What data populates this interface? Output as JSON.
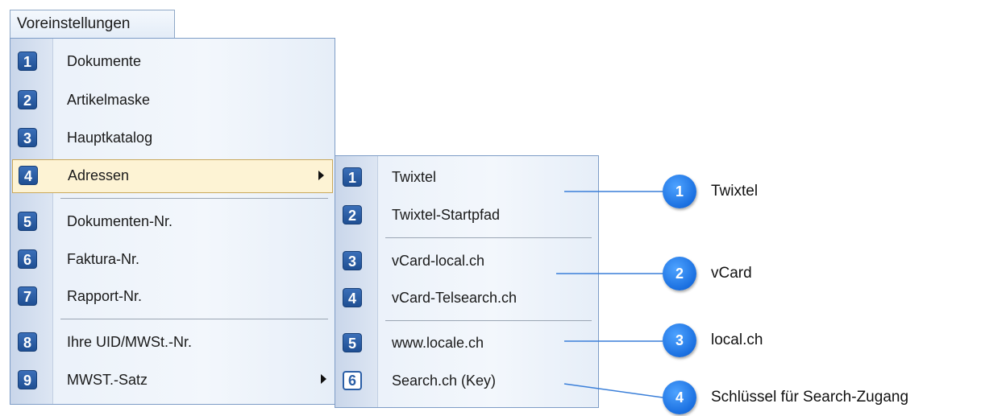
{
  "menubar": {
    "title": "Voreinstellungen"
  },
  "main_menu": {
    "items": [
      {
        "num": "1",
        "label": "Dokumente"
      },
      {
        "num": "2",
        "label": "Artikelmaske"
      },
      {
        "num": "3",
        "label": "Hauptkatalog"
      },
      {
        "num": "4",
        "label": "Adressen"
      },
      {
        "num": "5",
        "label": "Dokumenten-Nr."
      },
      {
        "num": "6",
        "label": "Faktura-Nr."
      },
      {
        "num": "7",
        "label": "Rapport-Nr."
      },
      {
        "num": "8",
        "label": "Ihre UID/MWSt.-Nr."
      },
      {
        "num": "9",
        "label": "MWST.-Satz"
      }
    ]
  },
  "sub_menu": {
    "items": [
      {
        "num": "1",
        "label": "Twixtel"
      },
      {
        "num": "2",
        "label": "Twixtel-Startpfad"
      },
      {
        "num": "3",
        "label": "vCard-local.ch"
      },
      {
        "num": "4",
        "label": "vCard-Telsearch.ch"
      },
      {
        "num": "5",
        "label": "www.locale.ch"
      },
      {
        "num": "6",
        "label": "Search.ch (Key)"
      }
    ]
  },
  "callouts": [
    {
      "num": "1",
      "text": "Twixtel"
    },
    {
      "num": "2",
      "text": "vCard"
    },
    {
      "num": "3",
      "text": "local.ch"
    },
    {
      "num": "4",
      "text": "Schlüssel für Search-Zugang"
    }
  ],
  "colors": {
    "callout": "#1a6fe0",
    "menu_border": "#7d9cc6",
    "highlight": "#fdf3d4"
  }
}
